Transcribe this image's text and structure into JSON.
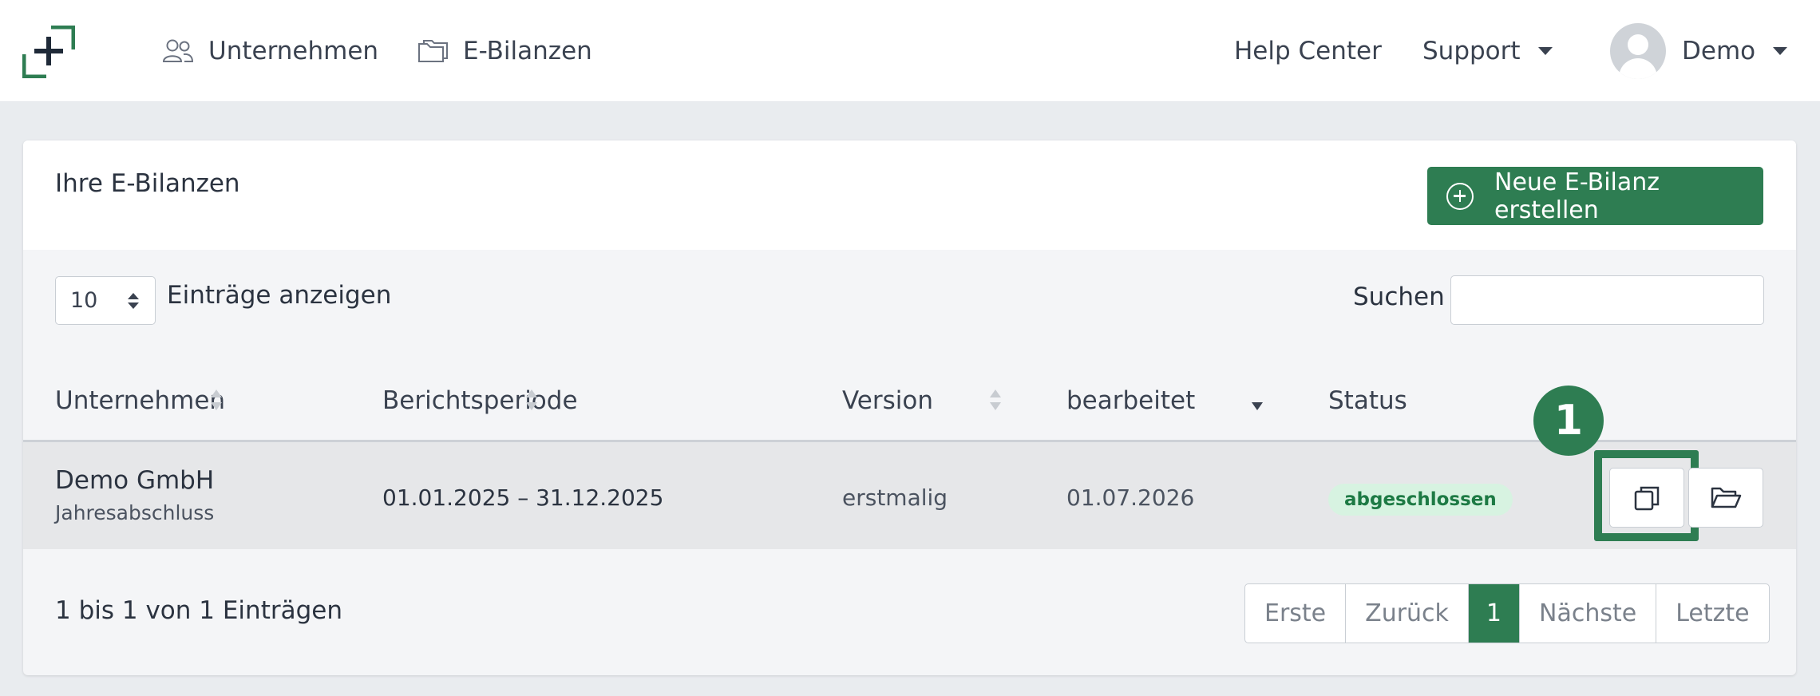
{
  "nav": {
    "unternehmen": "Unternehmen",
    "ebilanzen": "E-Bilanzen",
    "help_center": "Help Center",
    "support": "Support",
    "user": "Demo"
  },
  "card": {
    "title": "Ihre E-Bilanzen",
    "new_button": "Neue E-Bilanz erstellen",
    "length_value": "10",
    "length_label": "Einträge anzeigen",
    "search_label": "Suchen",
    "search_value": ""
  },
  "table": {
    "headers": [
      "Unternehmen",
      "Berichtsperiode",
      "Version",
      "bearbeitet",
      "Status"
    ],
    "rows": [
      {
        "company": "Demo GmbH",
        "type": "Jahresabschluss",
        "period": "01.01.2025 – 31.12.2025",
        "version": "erstmalig",
        "edited": "01.07.2026",
        "status": "abgeschlossen"
      }
    ]
  },
  "callout": {
    "number": "1"
  },
  "footer": {
    "info": "1 bis 1 von 1 Einträgen",
    "pagination": [
      "Erste",
      "Zurück",
      "1",
      "Nächste",
      "Letzte"
    ]
  },
  "colors": {
    "brand_green": "#2e7d52",
    "badge_bg": "#d7f3e1",
    "badge_text": "#1d7a44"
  }
}
